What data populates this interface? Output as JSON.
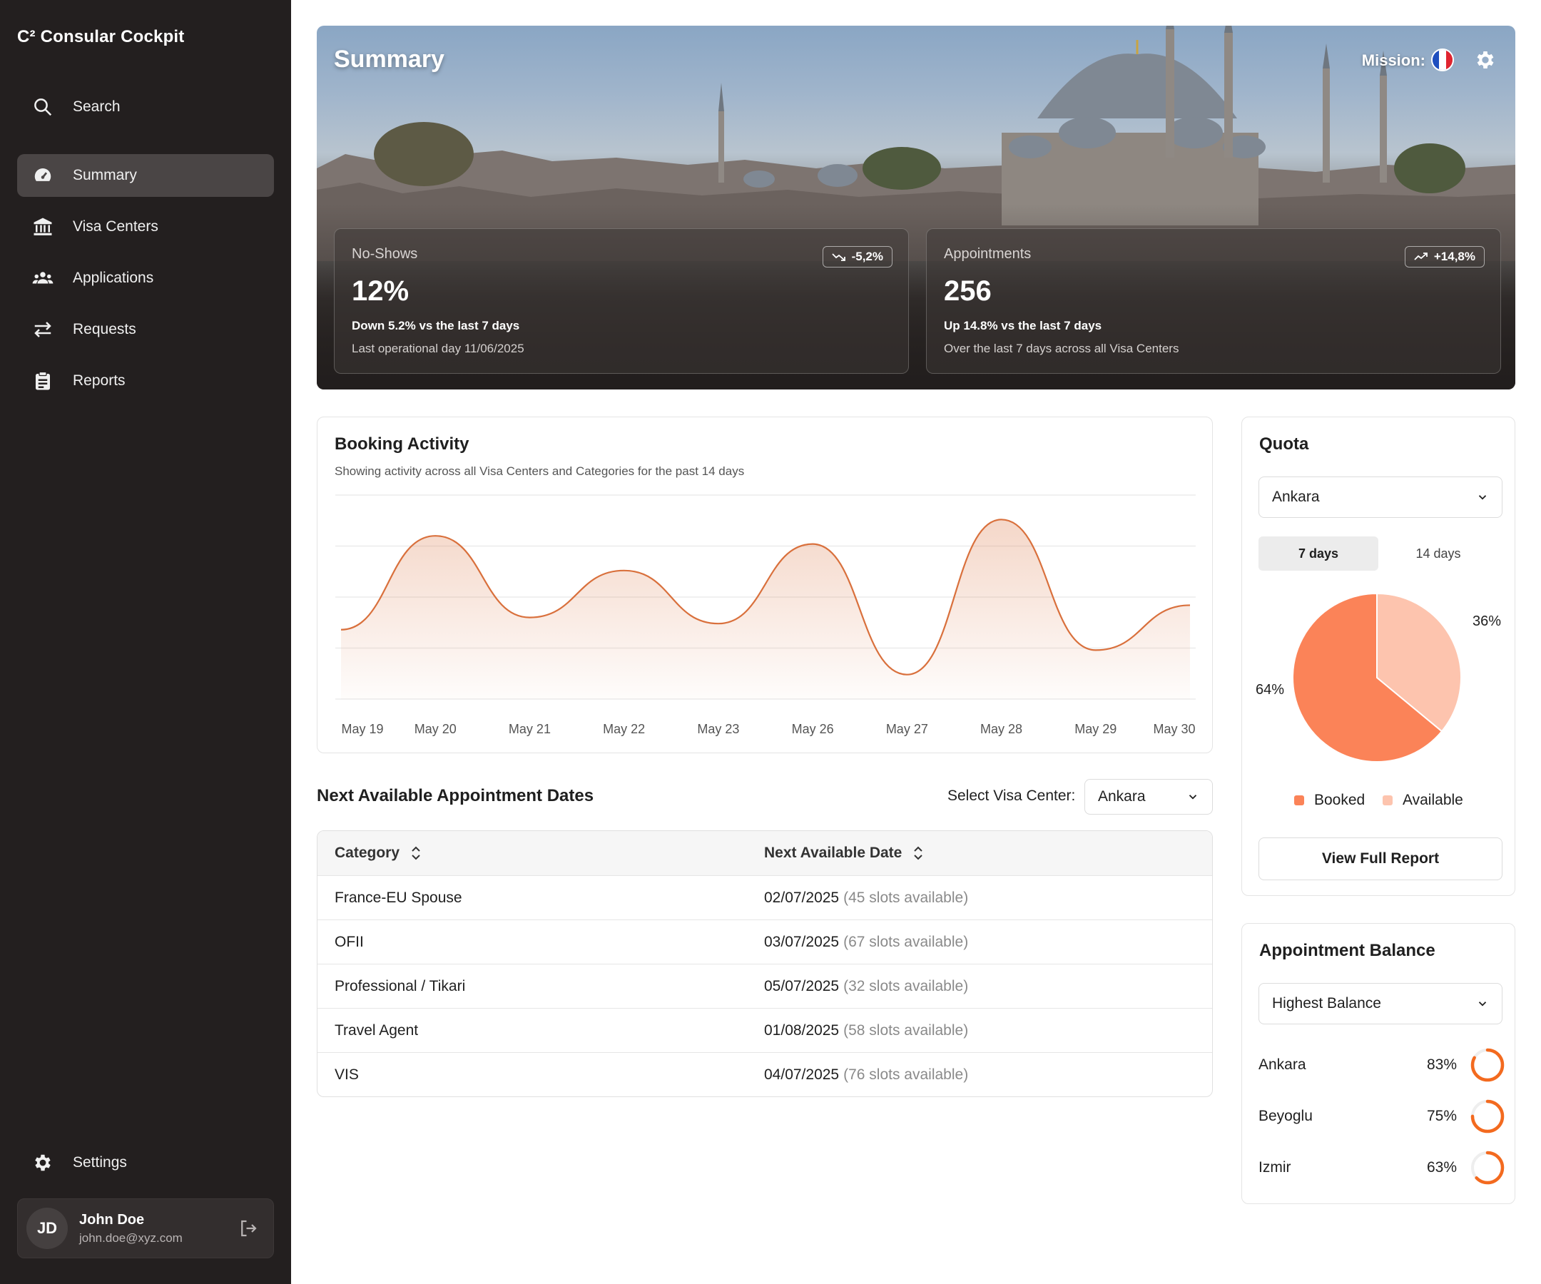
{
  "sidebar": {
    "brand": "C² Consular Cockpit",
    "search_label": "Search",
    "items": [
      {
        "label": "Summary"
      },
      {
        "label": "Visa Centers"
      },
      {
        "label": "Applications"
      },
      {
        "label": "Requests"
      },
      {
        "label": "Reports"
      }
    ],
    "settings_label": "Settings",
    "user": {
      "initials": "JD",
      "name": "John Doe",
      "email": "john.doe@xyz.com"
    }
  },
  "hero": {
    "title": "Summary",
    "mission_label": "Mission:",
    "flag_colors": [
      "#1f4fbf",
      "#ffffff",
      "#e0242f"
    ]
  },
  "stats": [
    {
      "label": "No-Shows",
      "value": "12%",
      "badge": "-5,2%",
      "line1": "Down 5.2% vs the last 7 days",
      "line2": "Last operational day 11/06/2025"
    },
    {
      "label": "Appointments",
      "value": "256",
      "badge": "+14,8%",
      "line1": "Up 14.8% vs the last 7 days",
      "line2": "Over the last 7 days across all Visa Centers"
    }
  ],
  "booking": {
    "title": "Booking Activity",
    "subtitle": "Showing activity across all Visa Centers and Categories for the past 14 days"
  },
  "chart_data": {
    "type": "area",
    "categories": [
      "May 19",
      "May 20",
      "May 21",
      "May 22",
      "May 23",
      "May 26",
      "May 27",
      "May 28",
      "May 29",
      "May 30"
    ],
    "values": [
      68,
      160,
      80,
      126,
      74,
      152,
      24,
      176,
      48,
      92
    ],
    "ylim": [
      0,
      200
    ],
    "grid": true,
    "color": "#d9703c"
  },
  "next_dates": {
    "title": "Next Available Appointment Dates",
    "select_label": "Select Visa Center:",
    "select_value": "Ankara",
    "headers": [
      "Category",
      "Next Available Date"
    ],
    "rows": [
      {
        "category": "France-EU Spouse",
        "date": "02/07/2025",
        "slots": "(45 slots available)"
      },
      {
        "category": "OFII",
        "date": "03/07/2025",
        "slots": "(67 slots available)"
      },
      {
        "category": "Professional / Tikari",
        "date": "05/07/2025",
        "slots": "(32 slots available)"
      },
      {
        "category": "Travel Agent",
        "date": "01/08/2025",
        "slots": "(58 slots available)"
      },
      {
        "category": "VIS",
        "date": "04/07/2025",
        "slots": "(76 slots available)"
      }
    ]
  },
  "quota": {
    "title": "Quota",
    "select_value": "Ankara",
    "tabs": [
      "7 days",
      "14 days"
    ],
    "booked_pct": "64%",
    "available_pct": "36%",
    "booked_value": 64,
    "legend_booked": "Booked",
    "legend_available": "Available",
    "booked_color": "#fb8358",
    "available_color": "#fdc4ae",
    "button": "View Full Report"
  },
  "balance": {
    "title": "Appointment Balance",
    "select_value": "Highest Balance",
    "ring_color": "#f36a1f",
    "rows": [
      {
        "name": "Ankara",
        "pct": "83%",
        "value": 83
      },
      {
        "name": "Beyoglu",
        "pct": "75%",
        "value": 75
      },
      {
        "name": "Izmir",
        "pct": "63%",
        "value": 63
      }
    ]
  }
}
